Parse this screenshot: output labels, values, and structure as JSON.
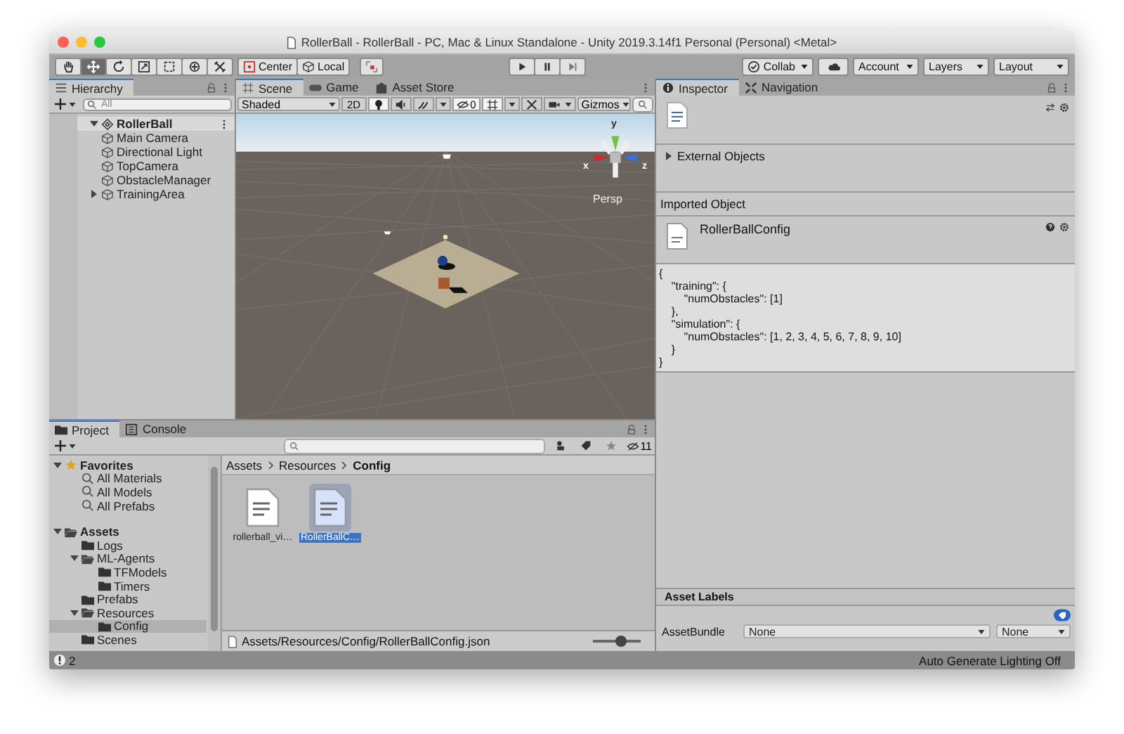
{
  "window": {
    "title": "RollerBall - RollerBall - PC, Mac & Linux Standalone - Unity 2019.3.14f1 Personal (Personal) <Metal>"
  },
  "toolbar": {
    "tools": [
      {
        "kind": "hand",
        "selected": false
      },
      {
        "kind": "move",
        "selected": true
      },
      {
        "kind": "rotate",
        "selected": false
      },
      {
        "kind": "scale",
        "selected": false
      },
      {
        "kind": "rect",
        "selected": false
      },
      {
        "kind": "transform",
        "selected": false
      },
      {
        "kind": "custom",
        "selected": false
      }
    ],
    "pivot_mode": "Center",
    "pivot_rotation": "Local",
    "collab": "Collab",
    "account": "Account",
    "layers": "Layers",
    "layout": "Layout"
  },
  "hierarchy": {
    "tab": "Hierarchy",
    "placeholder": "All",
    "items": [
      {
        "label": "RollerBall",
        "kind": "scene",
        "expanded": true,
        "children": [
          {
            "label": "Main Camera",
            "kind": "object"
          },
          {
            "label": "Directional Light",
            "kind": "object"
          },
          {
            "label": "TopCamera",
            "kind": "object"
          },
          {
            "label": "ObstacleManager",
            "kind": "object"
          },
          {
            "label": "TrainingArea",
            "kind": "object",
            "expanded": false
          }
        ]
      }
    ]
  },
  "scene": {
    "tabs": [
      {
        "label": "Scene",
        "kind": "scene",
        "selected": true
      },
      {
        "label": "Game",
        "kind": "game",
        "selected": false
      },
      {
        "label": "Asset Store",
        "kind": "store",
        "selected": false
      }
    ],
    "draw_mode": "Shaded",
    "mode_2d": "2D",
    "toggles": [
      {
        "kind": "lighting",
        "on": true
      },
      {
        "kind": "audio",
        "on": false
      },
      {
        "kind": "effects",
        "on": false
      }
    ],
    "hidden_count": "0",
    "hidden_on": true,
    "grid_on": true,
    "gizmos": "Gizmos",
    "axes": [
      "y",
      "x",
      "z"
    ],
    "projection": "Persp"
  },
  "project": {
    "tabs": [
      {
        "label": "Project",
        "kind": "project",
        "selected": true
      },
      {
        "label": "Console",
        "kind": "console",
        "selected": false
      }
    ],
    "hidden_count": "11",
    "tree": [
      {
        "label": "Favorites",
        "kind": "favorites",
        "expanded": true,
        "selected": false,
        "children": [
          {
            "label": "All Materials",
            "kind": "search",
            "selected": false
          },
          {
            "label": "All Models",
            "kind": "search",
            "selected": false
          },
          {
            "label": "All Prefabs",
            "kind": "search",
            "selected": false
          }
        ]
      },
      {
        "label": "Assets",
        "kind": "folder",
        "expanded": true,
        "selected": false,
        "children": [
          {
            "label": "Logs",
            "kind": "folder",
            "selected": false
          },
          {
            "label": "ML-Agents",
            "kind": "folder",
            "expanded": true,
            "selected": false,
            "children": [
              {
                "label": "TFModels",
                "kind": "folder",
                "selected": false
              },
              {
                "label": "Timers",
                "kind": "folder",
                "selected": false
              }
            ]
          },
          {
            "label": "Prefabs",
            "kind": "folder",
            "selected": false
          },
          {
            "label": "Resources",
            "kind": "folder",
            "expanded": true,
            "selected": false,
            "children": [
              {
                "label": "Config",
                "kind": "folder",
                "selected": true
              }
            ]
          },
          {
            "label": "Scenes",
            "kind": "folder",
            "selected": false
          }
        ]
      }
    ],
    "breadcrumb": [
      "Assets",
      "Resources",
      "Config"
    ],
    "assets": [
      {
        "name": "rollerball_vi…",
        "selected": false
      },
      {
        "name": "RollerBallC…",
        "selected": true
      }
    ],
    "path": "Assets/Resources/Config/RollerBallConfig.json",
    "zoom": {
      "level": 0.6
    }
  },
  "inspector": {
    "tabs": [
      {
        "label": "Inspector",
        "kind": "inspector",
        "selected": true
      },
      {
        "label": "Navigation",
        "kind": "navigation",
        "selected": false
      }
    ],
    "external_objects": {
      "label": "External Objects",
      "expanded": false
    },
    "section": "Imported Object",
    "asset_name": "RollerBallConfig",
    "content": "{\n    \"training\": {\n        \"numObstacles\": [1]\n    },\n    \"simulation\": {\n        \"numObstacles\": [1, 2, 3, 4, 5, 6, 7, 8, 9, 10]\n    }\n}",
    "asset_labels": "Asset Labels",
    "asset_bundle": {
      "label": "AssetBundle",
      "name": "None",
      "variant": "None"
    }
  },
  "status_bar": {
    "warnings": "2",
    "lighting": "Auto Generate Lighting Off"
  }
}
